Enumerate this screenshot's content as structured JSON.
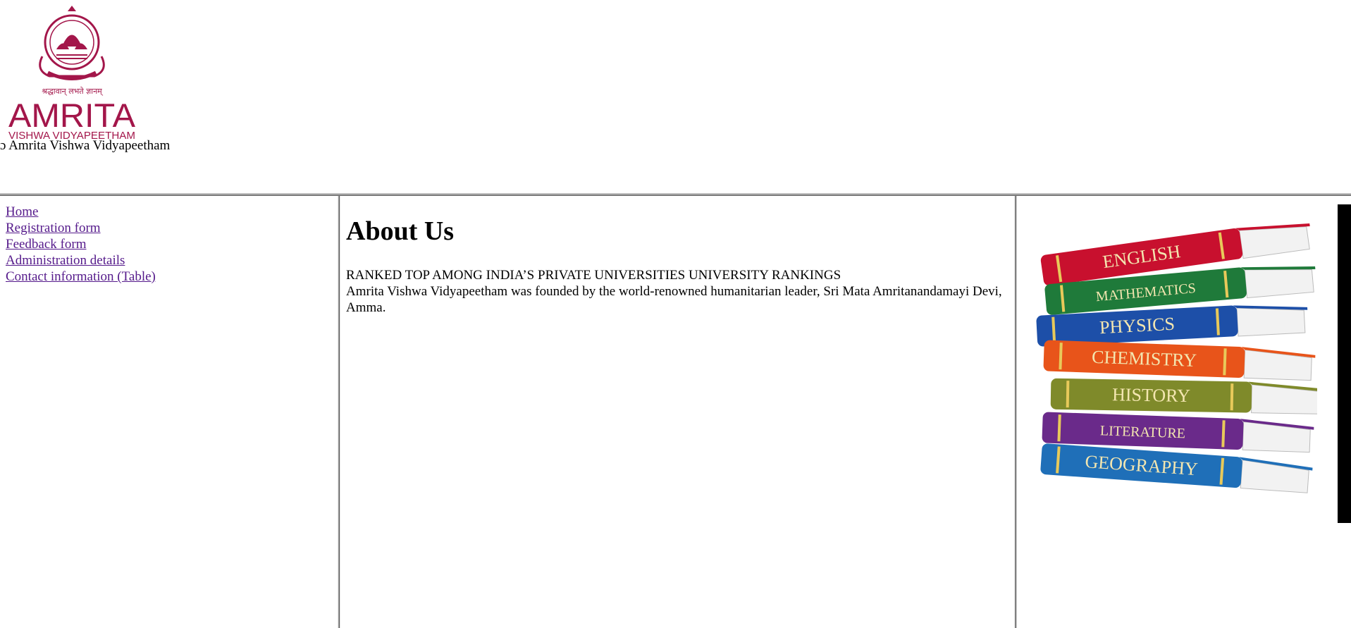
{
  "header": {
    "logo_text": "AMRITA",
    "logo_subtitle": "VISHWA VIDYAPEETHAM",
    "logo_motto": "श्रद्धावान् लभते ज्ञानम्",
    "caption": "ɔ Amrita Vishwa Vidyapeetham"
  },
  "nav": {
    "items": [
      {
        "label": "Home"
      },
      {
        "label": "Registration form"
      },
      {
        "label": "Feedback form"
      },
      {
        "label": "Administration details"
      },
      {
        "label": "Contact information (Table)"
      }
    ],
    "link_color": "#551a8b"
  },
  "main": {
    "title": "About Us",
    "ranking": "RANKED TOP AMONG INDIA’S PRIVATE UNIVERSITIES UNIVERSITY RANKINGS",
    "description": "Amrita Vishwa Vidyapeetham was founded by the world-renowned humanitarian leader, Sri Mata Amritanandamayi Devi, Amma."
  },
  "side": {
    "books": [
      "ENGLISH",
      "MATHEMATICS",
      "PHYSICS",
      "CHEMISTRY",
      "HISTORY",
      "LITERATURE",
      "GEOGRAPHY"
    ],
    "book_colors": [
      "#c8102e",
      "#1f7a3a",
      "#1d4fa8",
      "#e8541a",
      "#7f8a2a",
      "#6a2a8a",
      "#1f6fb8"
    ]
  },
  "colors": {
    "brand": "#a3164a"
  }
}
